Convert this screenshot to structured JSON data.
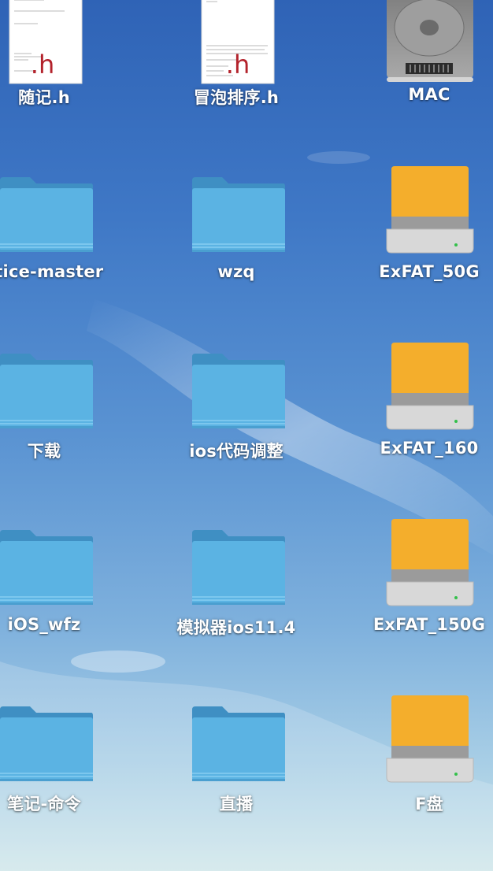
{
  "desktop": {
    "icons": [
      {
        "label": "随记.h",
        "kind": "header-file",
        "ext": ".h"
      },
      {
        "label": "冒泡排序.h",
        "kind": "header-file",
        "ext": ".h"
      },
      {
        "label": "MAC",
        "kind": "hard-disk"
      },
      {
        "label": "ctice-master",
        "kind": "folder"
      },
      {
        "label": "wzq",
        "kind": "folder"
      },
      {
        "label": "ExFAT_50G",
        "kind": "external-drive"
      },
      {
        "label": "下载",
        "kind": "folder"
      },
      {
        "label": "ios代码调整",
        "kind": "folder"
      },
      {
        "label": "ExFAT_160",
        "kind": "external-drive"
      },
      {
        "label": "iOS_wfz",
        "kind": "folder"
      },
      {
        "label": "模拟器ios11.4",
        "kind": "folder"
      },
      {
        "label": "ExFAT_150G",
        "kind": "external-drive"
      },
      {
        "label": "笔记-命令",
        "kind": "folder"
      },
      {
        "label": "直播",
        "kind": "folder"
      },
      {
        "label": "F盘",
        "kind": "external-drive"
      }
    ]
  },
  "colors": {
    "folder_body": "#5bb3e3",
    "folder_tab": "#3f8fc3",
    "drive_top": "#f4ae2c",
    "drive_base": "#cfcfcf",
    "wallpaper_top": "#2f63b6",
    "wallpaper_bottom": "#cfe6ea",
    "file_ext_color": "#b3222b"
  }
}
